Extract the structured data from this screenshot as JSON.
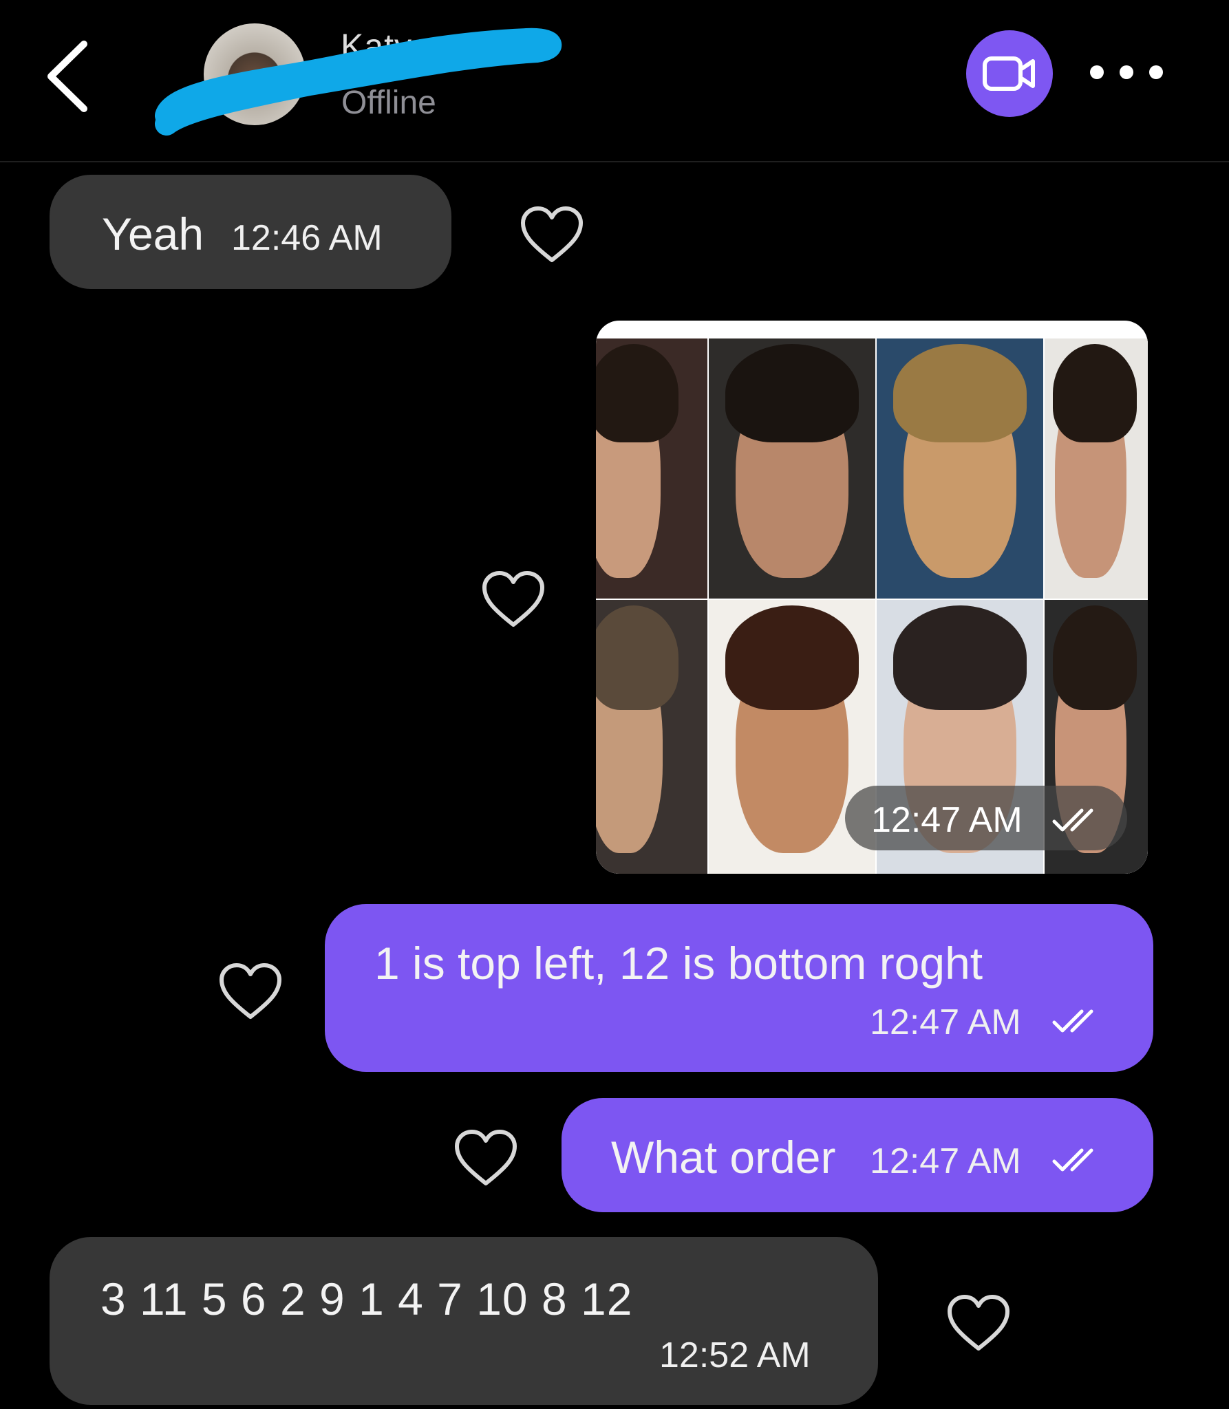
{
  "header": {
    "contact_name": "Katya",
    "status": "Offline",
    "back_icon": "chevron-left-icon",
    "video_icon": "video-camera-icon",
    "more_icon": "more-horizontal-icon",
    "accent_color": "#7e57f2"
  },
  "messages": [
    {
      "direction": "incoming",
      "text": "Yeah",
      "time": "12:46 AM"
    },
    {
      "direction": "outgoing",
      "type": "image",
      "time": "12:47 AM",
      "status": "read"
    },
    {
      "direction": "outgoing",
      "text": "1 is top left, 12 is bottom roght",
      "time": "12:47 AM",
      "status": "read"
    },
    {
      "direction": "outgoing",
      "text": "What order",
      "time": "12:47 AM",
      "status": "read"
    },
    {
      "direction": "incoming",
      "text": "3 11 5 6 2 9 1 4 7 10 8 12",
      "time": "12:52 AM"
    }
  ],
  "colors": {
    "background": "#000000",
    "incoming_bubble": "#373737",
    "outgoing_bubble": "#7d56f2"
  }
}
